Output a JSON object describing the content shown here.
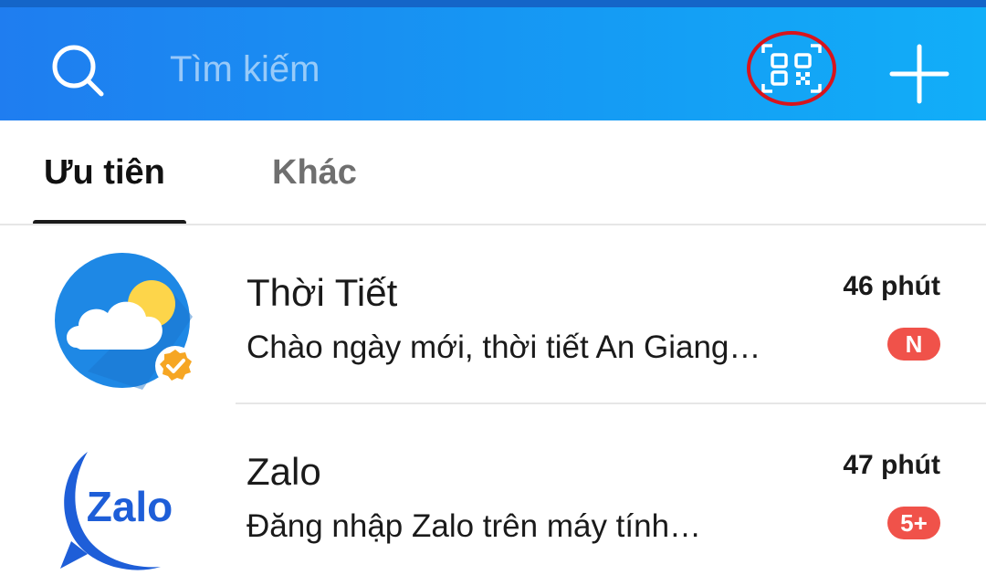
{
  "header": {
    "search_placeholder": "Tìm kiếm",
    "icons": [
      "search-icon",
      "qr-code-icon",
      "plus-icon"
    ],
    "gradient_colors": [
      "#1f7df0",
      "#11aef8"
    ],
    "highlight_color": "#d8141c"
  },
  "tabs": [
    {
      "label": "Ưu tiên",
      "active": true
    },
    {
      "label": "Khác",
      "active": false
    }
  ],
  "conversations": [
    {
      "name": "Thời Tiết",
      "time": "46 phút",
      "preview": "Chào ngày mới, thời tiết An Giang…",
      "badge": "N",
      "avatar_icon": "weather-cloud-sun-icon",
      "verified_icon": "verified-check-icon"
    },
    {
      "name": "Zalo",
      "time": "47 phút",
      "preview": "Đăng nhập Zalo trên máy tính…",
      "badge": "5+",
      "avatar_icon": "zalo-logo-icon",
      "logo_text": "Zalo"
    }
  ],
  "colors": {
    "badge": "#f0524a",
    "zalo_blue": "#1e5ed8",
    "verified_orange": "#f6a623"
  }
}
